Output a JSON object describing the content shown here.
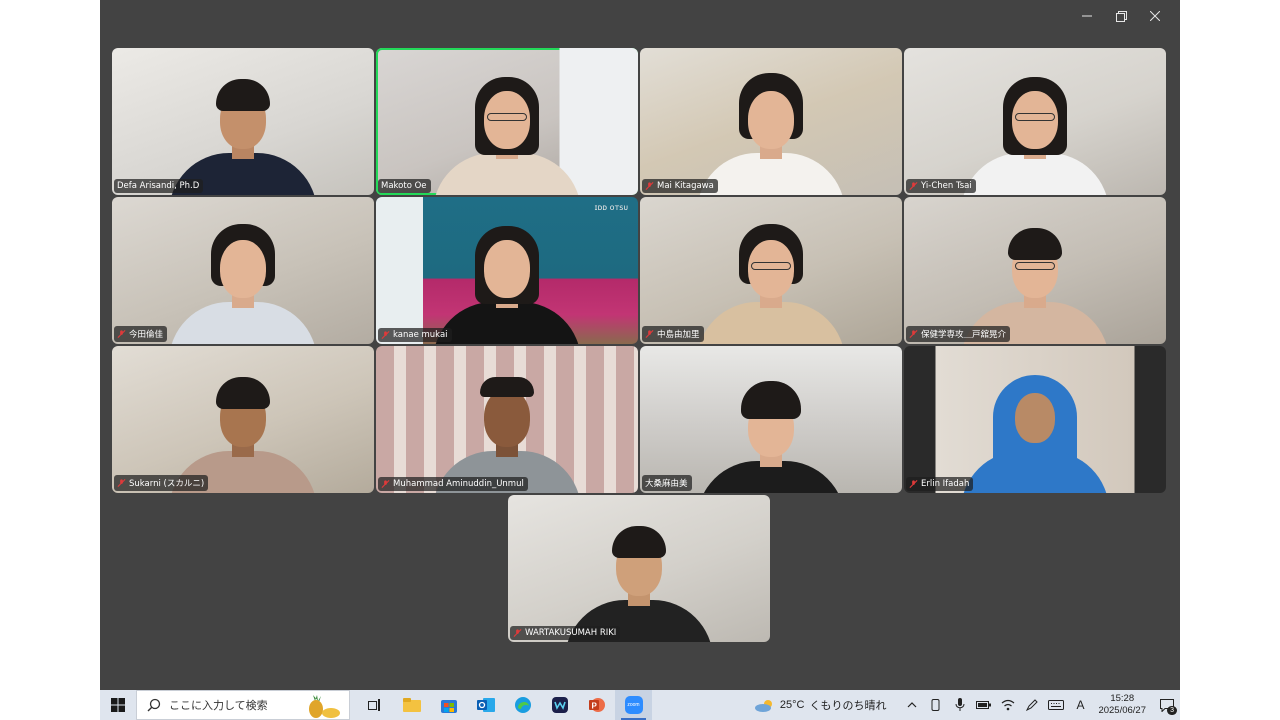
{
  "window": {
    "minimize_icon": "minimize-icon",
    "restore_icon": "restore-icon",
    "close_icon": "close-icon"
  },
  "participants": [
    {
      "name": "Defa Arisandi, Ph.D",
      "muted": false,
      "active": false
    },
    {
      "name": "Makoto Oe",
      "muted": false,
      "active": true
    },
    {
      "name": "Mai Kitagawa",
      "muted": true,
      "active": false
    },
    {
      "name": "Yi-Chen Tsai",
      "muted": true,
      "active": false
    },
    {
      "name": "今田倫佳",
      "muted": true,
      "active": false
    },
    {
      "name": "kanae mukai",
      "muted": true,
      "active": false
    },
    {
      "name": "中島由加里",
      "muted": true,
      "active": false
    },
    {
      "name": "保健学専攻＿戸舘晃介",
      "muted": true,
      "active": false
    },
    {
      "name": "Sukarni (スカルニ)",
      "muted": true,
      "active": false
    },
    {
      "name": "Muhammad Aminuddin_Unmul",
      "muted": true,
      "active": false
    },
    {
      "name": "大桑麻由美",
      "muted": false,
      "active": false
    },
    {
      "name": "Erlin Ifadah",
      "muted": true,
      "active": false
    },
    {
      "name": "WARTAKUSUMAH RIKI",
      "muted": true,
      "active": false
    }
  ],
  "tile_overlay": {
    "ooo_text": "ɪᴅᴅ ᴏᴛsᴜ"
  },
  "taskbar": {
    "search_placeholder": "ここに入力して検索",
    "apps": [
      "task-view",
      "file-explorer",
      "microsoft-store",
      "outlook",
      "edge",
      "webex",
      "powerpoint",
      "zoom"
    ],
    "active_app": "zoom",
    "zoom_label": "zoom",
    "weather_temp": "25°C",
    "weather_text": "くもりのち晴れ",
    "ime_letter": "A",
    "time": "15:28",
    "date": "2025/06/27",
    "notification_count": "3"
  },
  "colors": {
    "background": "#434343",
    "active_speaker": "#23d959",
    "taskbar": "#dfe5ee",
    "mute": "#e03a3a"
  }
}
